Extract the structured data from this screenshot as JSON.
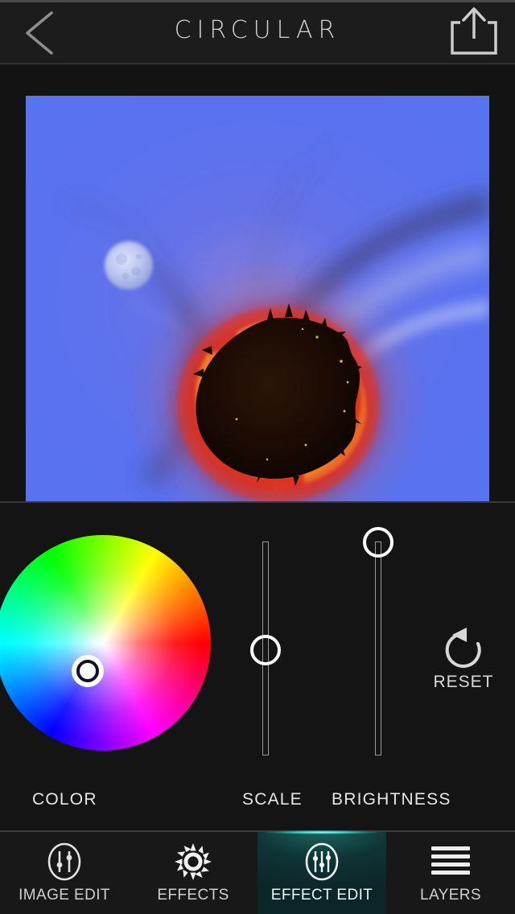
{
  "header": {
    "title": "CIRCULAR",
    "back_icon": "chevron-left-icon",
    "share_icon": "share-upload-icon"
  },
  "photo": {
    "description": "Stereographic tiny-planet photo: dark silhouetted land core ringed by red, orange and yellow sunset fire, surrounded by a swirling blue sky with a pale moon at upper left",
    "moon_label": "moon"
  },
  "controls": {
    "color": {
      "label": "COLOR",
      "selected_hex": "#7b5cf5",
      "selector_icon": "color-selector-ring"
    },
    "scale": {
      "label": "SCALE",
      "value_percent": 50
    },
    "brightness": {
      "label": "BRIGHTNESS",
      "value_percent": 100
    },
    "reset": {
      "label": "RESET",
      "icon": "undo-arrow-icon"
    }
  },
  "tabbar": {
    "active_tab": "EFFECT EDIT",
    "accent_hex": "#36d9c4",
    "items": [
      {
        "label": "IMAGE EDIT",
        "icon": "sliders-circle-icon",
        "active": false
      },
      {
        "label": "EFFECTS",
        "icon": "sun-burst-icon",
        "active": false
      },
      {
        "label": "EFFECT EDIT",
        "icon": "sliders-circle-icon",
        "active": true
      },
      {
        "label": "LAYERS",
        "icon": "stacked-lines-icon",
        "active": false
      }
    ]
  }
}
